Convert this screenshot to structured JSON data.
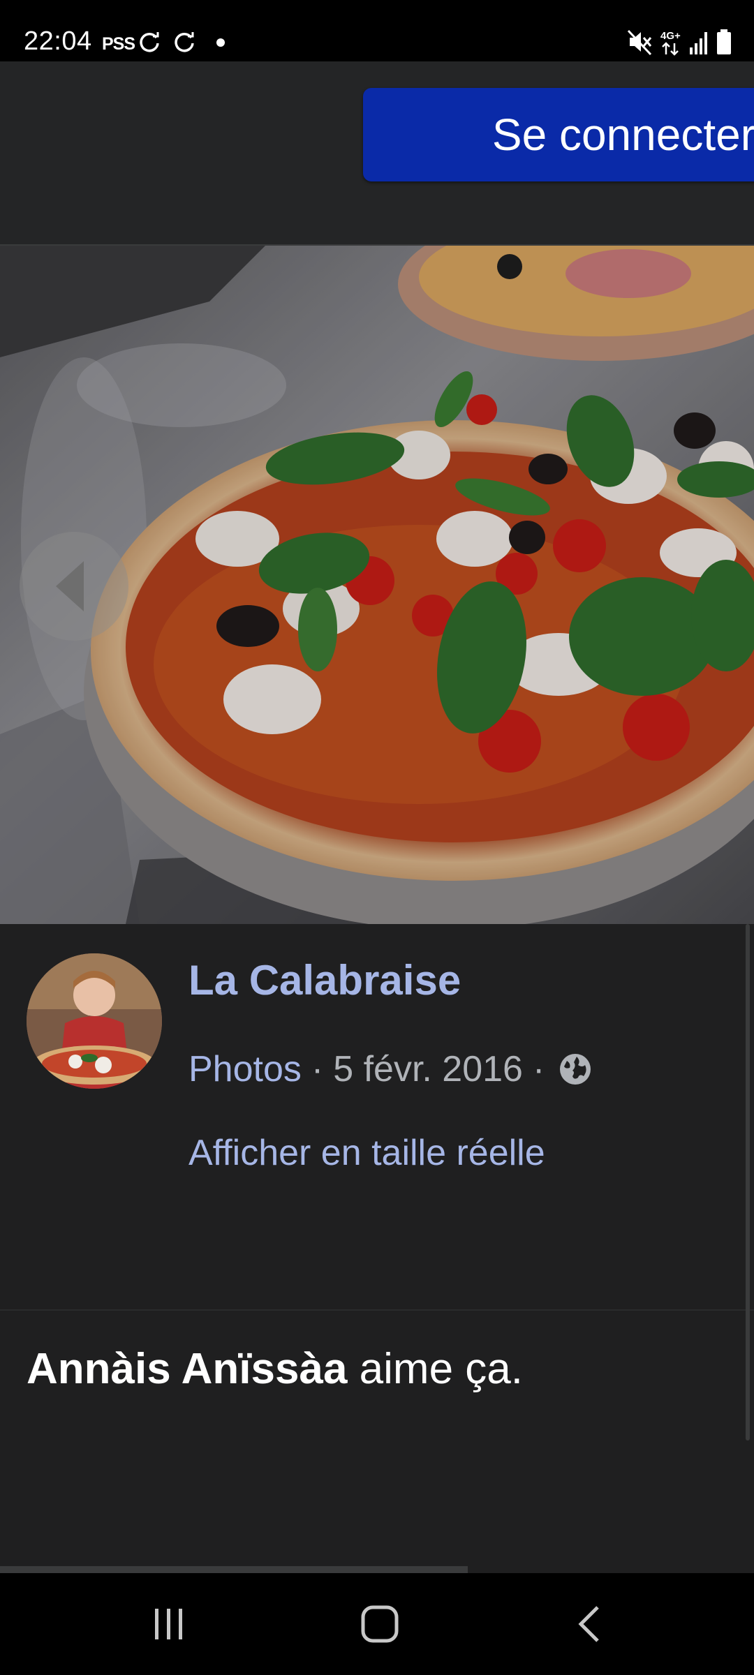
{
  "status_bar": {
    "time": "22:04",
    "label": "PSS",
    "icons": [
      "sync-icon",
      "sync-icon",
      "dot-icon",
      "mute-icon",
      "network-4g-icon",
      "signal-icon",
      "battery-icon"
    ],
    "network": "4G+"
  },
  "header": {
    "connect_label": "Se connecter",
    "accent_color": "#0a2aa8"
  },
  "photo": {
    "subject": "pizza",
    "prev_icon": "chevron-left-icon"
  },
  "post": {
    "page_name": "La Calabraise",
    "album_link": "Photos",
    "separator": "·",
    "date": "5 févr. 2016",
    "privacy_icon": "globe-icon",
    "fullsize_label": "Afficher en taille réelle"
  },
  "likes": {
    "name": "Annàis Anïssàa",
    "suffix": " aime ça."
  },
  "progress": {
    "fraction": 0.62
  },
  "nav_bar": {
    "icons": [
      "recent-apps-icon",
      "home-icon",
      "back-icon"
    ]
  }
}
